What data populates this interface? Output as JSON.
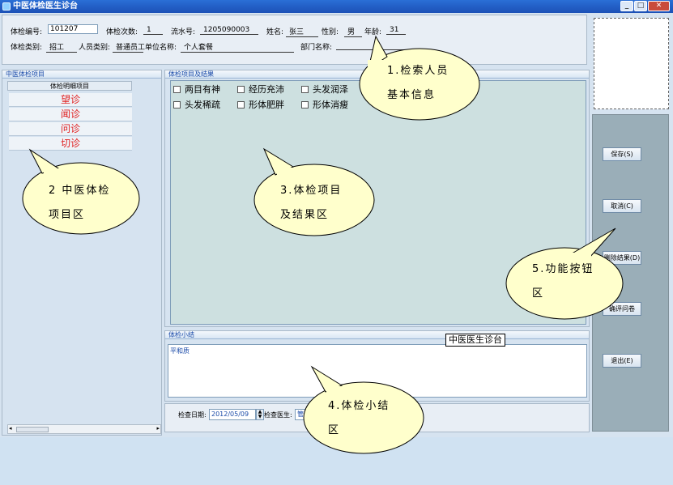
{
  "window": {
    "title": "中医体检医生诊台",
    "min": "_",
    "max": "□",
    "close": "✕"
  },
  "info": {
    "exam_no_label": "体检编号:",
    "exam_no": "101207",
    "count_label": "体检次数:",
    "count": "1",
    "serial_label": "流水号:",
    "serial": "1205090003",
    "name_label": "姓名:",
    "name": "张三",
    "gender_label": "性别:",
    "gender": "男",
    "age_label": "年龄:",
    "age": "31",
    "exam_type_label": "体检类别:",
    "exam_type": "招工",
    "person_type_label": "人员类别:",
    "person_type": "普通员工",
    "unit_label": "单位名称:",
    "unit": "个人套餐",
    "dept_label": "部门名称:",
    "dept": ""
  },
  "left": {
    "group_title": "中医体检项目",
    "list_header": "体检明细项目",
    "items": [
      "望诊",
      "闻诊",
      "问诊",
      "切诊"
    ]
  },
  "items_panel": {
    "group_title": "体检项目及结果",
    "checks": [
      "两目有神",
      "经历充沛",
      "头发润泽",
      "头发稀疏",
      "形体肥胖",
      "形体消瘦"
    ]
  },
  "summary": {
    "group_title": "体检小结",
    "text": "平和质",
    "tooltip": "中医医生诊台"
  },
  "date_panel": {
    "date_label": "检查日期:",
    "date": "2012/05/09",
    "doctor_label": "检查医生:",
    "doctor": "管"
  },
  "buttons": {
    "save": "保存(S)",
    "cancel": "取消(C)",
    "delete": "删除结果(D)",
    "review": "确评问卷",
    "exit": "退出(E)"
  },
  "callouts": {
    "c1_line1": "1.检索人员",
    "c1_line2": "基本信息",
    "c2_line1": "2 中医体检",
    "c2_line2": "项目区",
    "c3_line1": "3.体检项目",
    "c3_line2": "及结果区",
    "c4_line1": "4.体检小结",
    "c4_line2": "区",
    "c5_line1": "5.功能按钮",
    "c5_line2": "区"
  },
  "colors": {
    "titlebar": "#1c50b6",
    "callout_fill": "#ffffcc",
    "diagnosis_text": "#e02020"
  }
}
